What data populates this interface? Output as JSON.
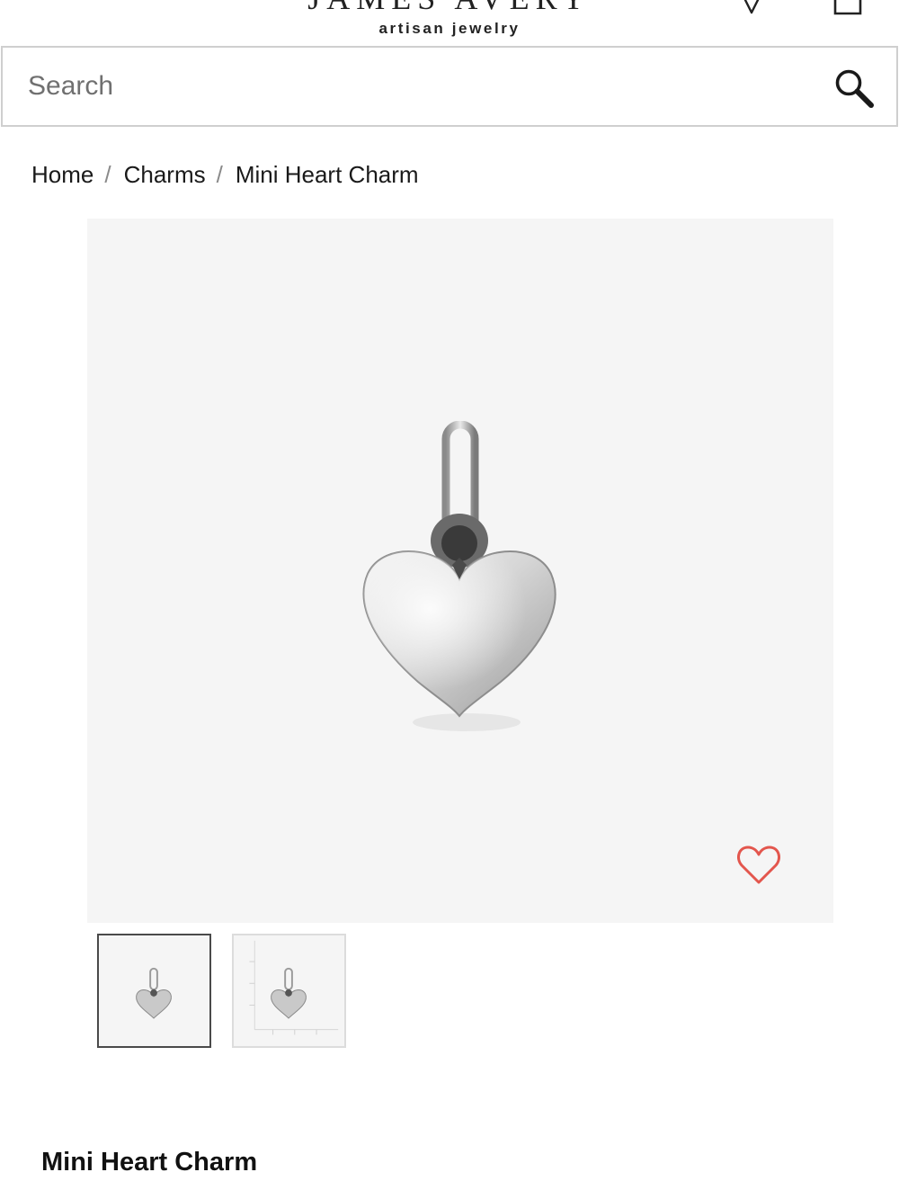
{
  "header": {
    "brand_name": "JAMES AVERY",
    "brand_tagline": "artisan jewelry",
    "icons": {
      "menu": "menu-icon",
      "logo_mark": "flame-logo-icon",
      "store": "location-pin-icon",
      "bag": "shopping-bag-icon"
    }
  },
  "search": {
    "placeholder": "Search",
    "value": "",
    "icon": "search-icon"
  },
  "breadcrumb": {
    "items": [
      {
        "label": "Home"
      },
      {
        "label": "Charms"
      },
      {
        "label": "Mini Heart Charm"
      }
    ],
    "separator": "/"
  },
  "gallery": {
    "main_image": "silver-heart-charm",
    "wishlist_icon": "heart-outline-icon",
    "wishlist_color": "#e3564d",
    "background_color": "#f5f5f5",
    "thumbnails": [
      {
        "image": "silver-heart-charm",
        "selected": true
      },
      {
        "image": "silver-heart-charm-with-scale",
        "selected": false
      }
    ]
  },
  "product": {
    "title": "Mini Heart Charm"
  }
}
